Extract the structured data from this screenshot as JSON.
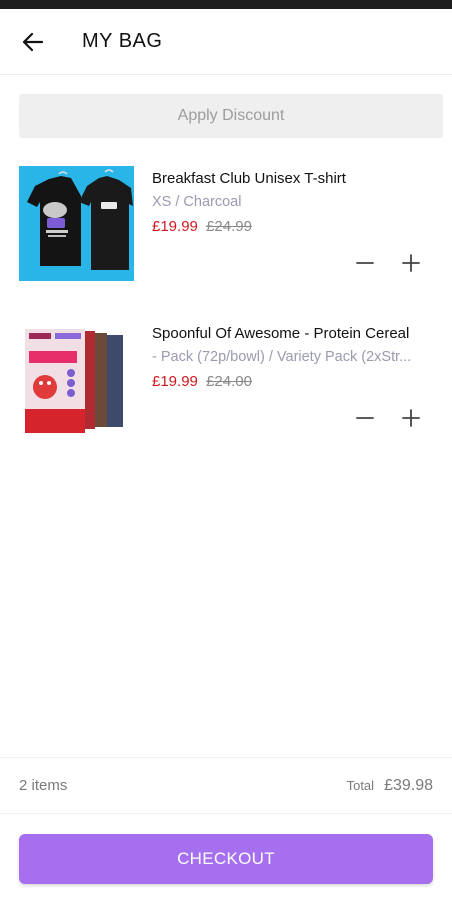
{
  "header": {
    "title": "MY BAG"
  },
  "discount": {
    "label": "Apply Discount"
  },
  "items": [
    {
      "name": "Breakfast Club Unisex T-shirt",
      "variant": "XS / Charcoal",
      "price": "£19.99",
      "was_price": "£24.99",
      "image": "black-tshirts-image"
    },
    {
      "name": "Spoonful Of Awesome - Protein Cereal",
      "variant": "- Pack (72p/bowl) / Variety Pack (2xStr...",
      "price": "£19.99",
      "was_price": "£24.00",
      "image": "protein-cereal-box-image"
    }
  ],
  "summary": {
    "item_count": "2 items",
    "total_label": "Total",
    "total_value": "£39.98"
  },
  "checkout": {
    "label": "CHECKOUT"
  },
  "colors": {
    "accent": "#a66ff0",
    "sale_price": "#d0191e",
    "muted": "#9d9d9d",
    "thumb_bg_1": "#29b5e8"
  }
}
